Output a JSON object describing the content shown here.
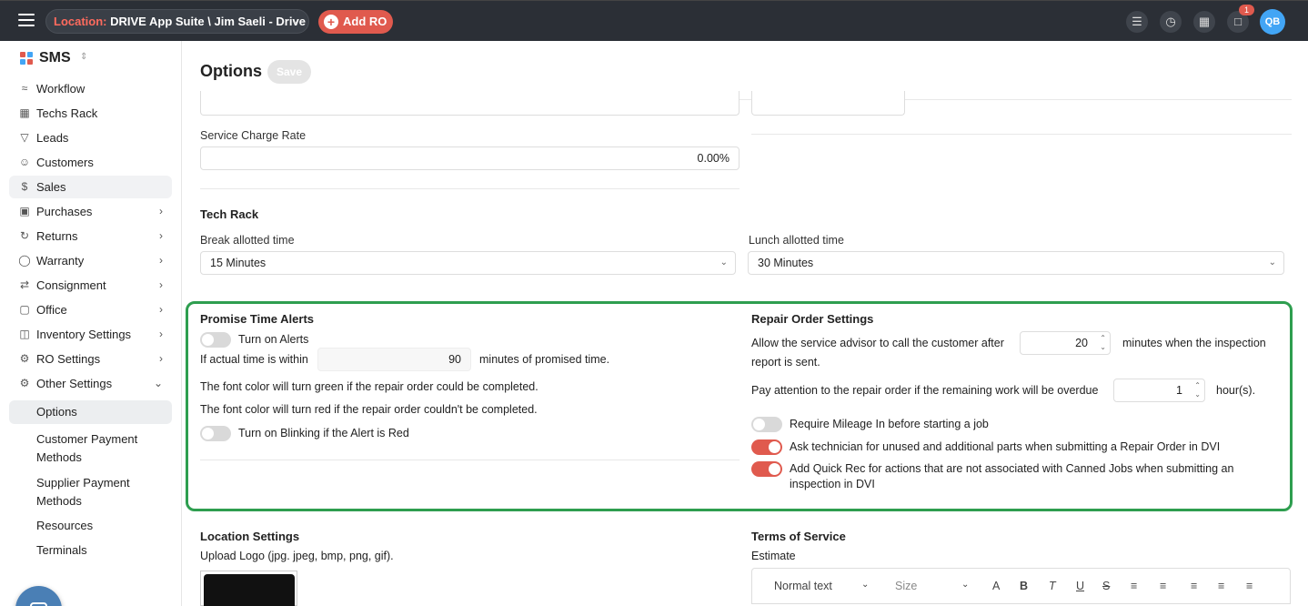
{
  "topbar": {
    "location_label": "Location:",
    "location_value": "DRIVE App Suite \\ Jim Saeli - Drive",
    "add_ro_label": "Add RO",
    "notification_count": "1",
    "avatar_initials": "QB"
  },
  "sidebar": {
    "brand": "SMS",
    "items": [
      {
        "label": "Workflow",
        "icon": "workflow-icon"
      },
      {
        "label": "Techs Rack",
        "icon": "grid-icon"
      },
      {
        "label": "Leads",
        "icon": "filter-icon"
      },
      {
        "label": "Customers",
        "icon": "users-icon"
      },
      {
        "label": "Sales",
        "icon": "dollar-icon"
      },
      {
        "label": "Purchases",
        "icon": "cart-icon"
      },
      {
        "label": "Returns",
        "icon": "refresh-icon"
      },
      {
        "label": "Warranty",
        "icon": "shield-icon"
      },
      {
        "label": "Consignment",
        "icon": "swap-icon"
      },
      {
        "label": "Office",
        "icon": "briefcase-icon"
      },
      {
        "label": "Inventory Settings",
        "icon": "box-icon"
      },
      {
        "label": "RO Settings",
        "icon": "gears-icon"
      },
      {
        "label": "Other Settings",
        "icon": "gear-icon"
      }
    ],
    "sub_items": [
      "Options",
      "Customer Payment Methods",
      "Supplier Payment Methods",
      "Resources",
      "Terminals"
    ]
  },
  "main": {
    "title": "Options",
    "save_label": "Save",
    "service_charge_label": "Service Charge Rate",
    "service_charge_value": "0.00%",
    "tech_rack_title": "Tech Rack",
    "break_label": "Break allotted time",
    "break_value": "15 Minutes",
    "lunch_label": "Lunch allotted time",
    "lunch_value": "30 Minutes",
    "promise": {
      "title": "Promise Time Alerts",
      "turn_on_alerts": "Turn on Alerts",
      "turn_on_alerts_state": false,
      "within_label": "If actual time is within",
      "within_value": "90",
      "within_suffix": "minutes of promised time.",
      "green_text": "The font color will turn green if the repair order could be completed.",
      "red_text": "The font color will turn red if the repair order couldn't be completed.",
      "blinking_label": "Turn on Blinking if the Alert is Red",
      "blinking_state": false
    },
    "repair": {
      "title": "Repair Order Settings",
      "call_label_1": "Allow the service advisor to call the customer after",
      "call_value": "20",
      "call_label_2": "minutes when the inspection",
      "call_label_3": "report is sent.",
      "overdue_label": "Pay attention to the repair order if the remaining work will be overdue",
      "overdue_value": "1",
      "overdue_suffix": "hour(s).",
      "mileage_label": "Require Mileage In before starting a job",
      "mileage_state": false,
      "parts_label": "Ask technician for unused and additional parts when submitting a Repair Order in DVI",
      "parts_state": true,
      "quickrec_label_1": "Add Quick Rec for actions that are not associated with Canned Jobs when submitting an",
      "quickrec_label_2": "inspection in DVI",
      "quickrec_state": true
    },
    "location_settings_title": "Location Settings",
    "upload_logo_label": "Upload Logo (jpg. jpeg, bmp, png, gif).",
    "terms_title": "Terms of Service",
    "estimate_label": "Estimate",
    "editor": {
      "format_value": "Normal text",
      "size_value": "Size"
    }
  },
  "colors": {
    "accent": "#e05a4e",
    "highlight": "#2e9e4f",
    "topbar": "#2b2f36"
  }
}
